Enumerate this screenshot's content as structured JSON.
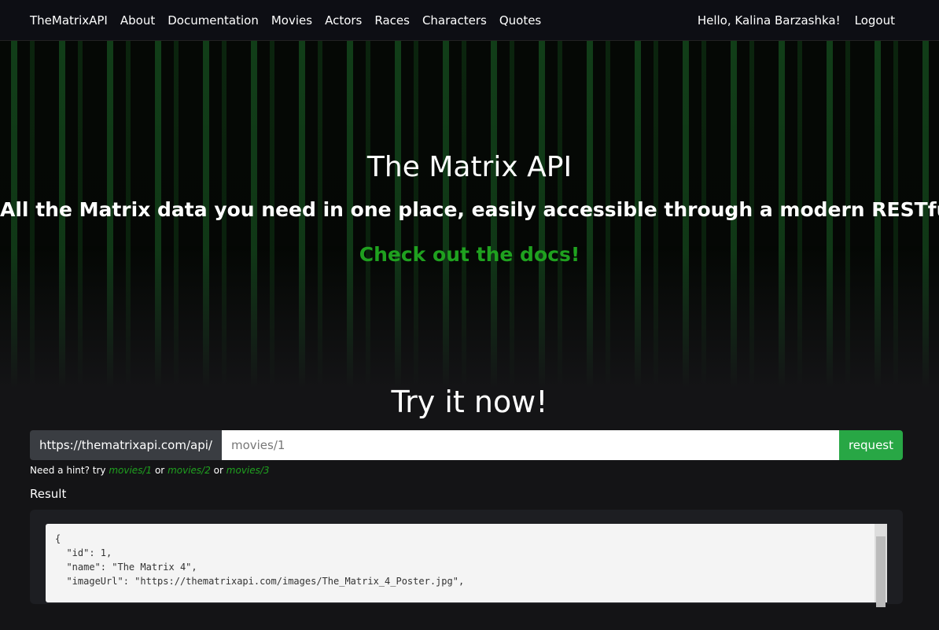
{
  "nav": {
    "brand": "TheMatrixAPI",
    "links": [
      "About",
      "Documentation",
      "Movies",
      "Actors",
      "Races",
      "Characters",
      "Quotes"
    ],
    "greeting": "Hello, Kalina Barzashka!",
    "logout": "Logout"
  },
  "hero": {
    "title": "The Matrix API",
    "subtitle": "All the Matrix data you need in one place, easily accessible through a modern RESTful API.",
    "docs_link": "Check out the docs!"
  },
  "try": {
    "heading": "Try it now!",
    "prefix": "https://thematrixapi.com/api/",
    "placeholder": "movies/1",
    "button": "request",
    "hint": {
      "text": "Need a hint? try",
      "or": "or",
      "links": [
        "movies/1",
        "movies/2",
        "movies/3"
      ]
    },
    "result_label": "Result",
    "result": "{\n  \"id\": 1,\n  \"name\": \"The Matrix 4\",\n  \"imageUrl\": \"https://thematrixapi.com/images/The_Matrix_4_Poster.jpg\","
  }
}
